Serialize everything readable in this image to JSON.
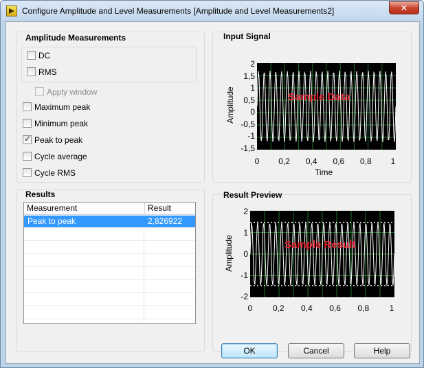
{
  "window": {
    "title": "Configure Amplitude and Level Measurements [Amplitude and Level Measurements2]",
    "close_label": "✕"
  },
  "amplitude": {
    "title": "Amplitude Measurements",
    "dc": {
      "label": "DC",
      "checked": false
    },
    "rms": {
      "label": "RMS",
      "checked": false
    },
    "apply_window": {
      "label": "Apply window",
      "checked": false,
      "disabled": true
    },
    "maximum_peak": {
      "label": "Maximum peak",
      "checked": false
    },
    "minimum_peak": {
      "label": "Minimum peak",
      "checked": false
    },
    "peak_to_peak": {
      "label": "Peak to peak",
      "checked": true
    },
    "cycle_average": {
      "label": "Cycle average",
      "checked": false
    },
    "cycle_rms": {
      "label": "Cycle RMS",
      "checked": false
    }
  },
  "results": {
    "title": "Results",
    "columns": [
      "Measurement",
      "Result"
    ],
    "rows": [
      {
        "measurement": "Peak to peak",
        "result": "2,826922",
        "selected": true
      }
    ]
  },
  "input_signal": {
    "title": "Input Signal",
    "sample_label": "Sample Data",
    "ylabel": "Amplitude",
    "xlabel": "Time",
    "yticks": [
      "2",
      "1,5",
      "1",
      "0,5",
      "0",
      "-0,5",
      "-1",
      "-1,5"
    ],
    "xticks": [
      "0",
      "0,2",
      "0,4",
      "0,6",
      "0,8",
      "1"
    ]
  },
  "result_preview": {
    "title": "Result Preview",
    "sample_label": "Sample Result",
    "ylabel": "Amplitude",
    "yticks": [
      "2",
      "1",
      "0",
      "-1",
      "-2"
    ],
    "xticks": [
      "0",
      "0,2",
      "0,4",
      "0,6",
      "0,8",
      "1"
    ]
  },
  "buttons": {
    "ok": "OK",
    "cancel": "Cancel",
    "help": "Help"
  },
  "colors": {
    "plot_bg": "#000000",
    "grid": "#1f6e2a",
    "trace": "#ffffff",
    "sample_text": "#e8222e",
    "selection": "#3399ff"
  }
}
